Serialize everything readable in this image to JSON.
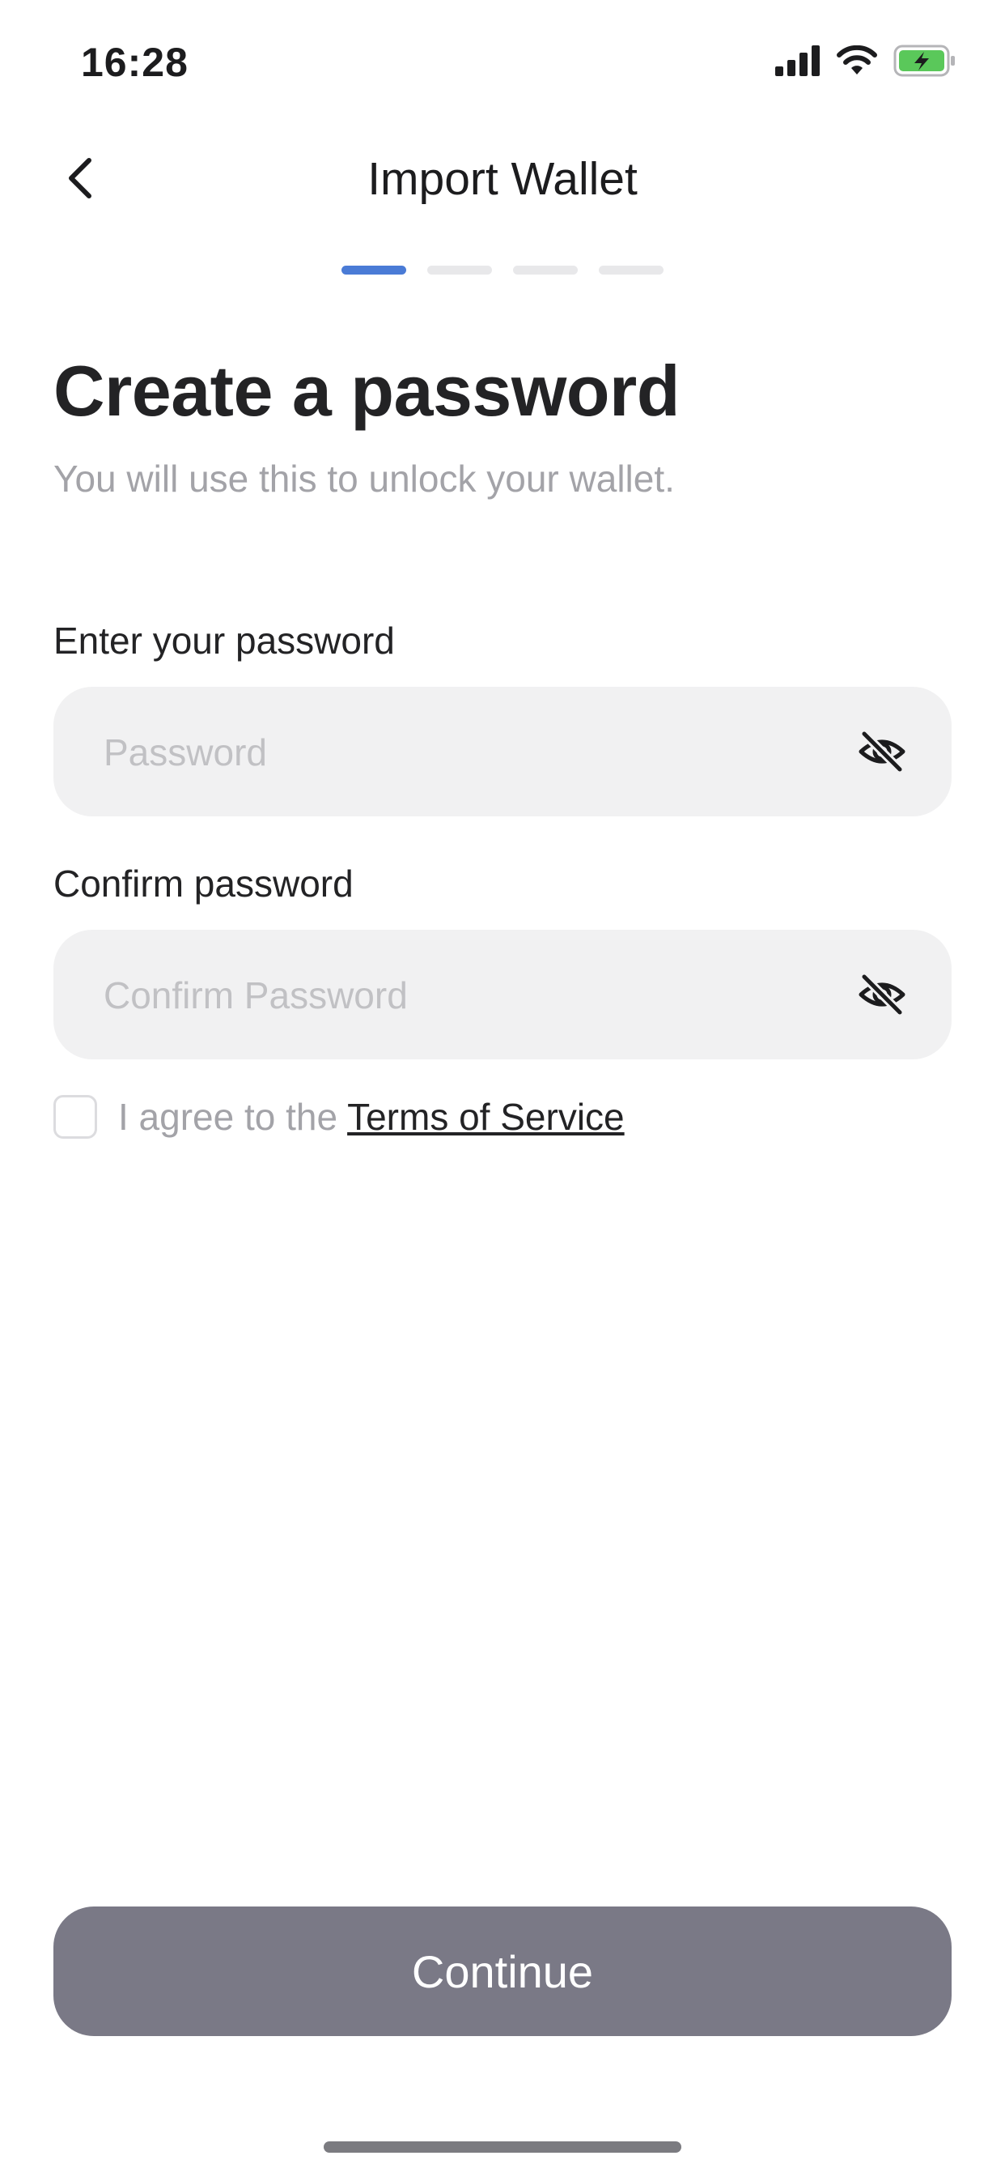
{
  "status_bar": {
    "time": "16:28",
    "icons": [
      "cellular-signal-icon",
      "wifi-icon",
      "battery-charging-icon"
    ]
  },
  "nav": {
    "title": "Import Wallet",
    "back_icon": "chevron-left-icon"
  },
  "progress": {
    "total_steps": 4,
    "current_step": 1
  },
  "page": {
    "heading": "Create a password",
    "subtext": "You will use this to unlock your wallet."
  },
  "form": {
    "password_label": "Enter your password",
    "password_placeholder": "Password",
    "password_value": "",
    "confirm_label": "Confirm password",
    "confirm_placeholder": "Confirm Password",
    "confirm_value": "",
    "visibility_icon": "eye-off-icon"
  },
  "terms": {
    "checked": false,
    "prefix": "I agree to the",
    "link": "Terms of Service"
  },
  "continue_label": "Continue",
  "colors": {
    "accent": "#4a7bd6",
    "button_disabled": "#7a7986",
    "field_background": "#f1f1f2",
    "battery_green": "#5ac85a"
  }
}
